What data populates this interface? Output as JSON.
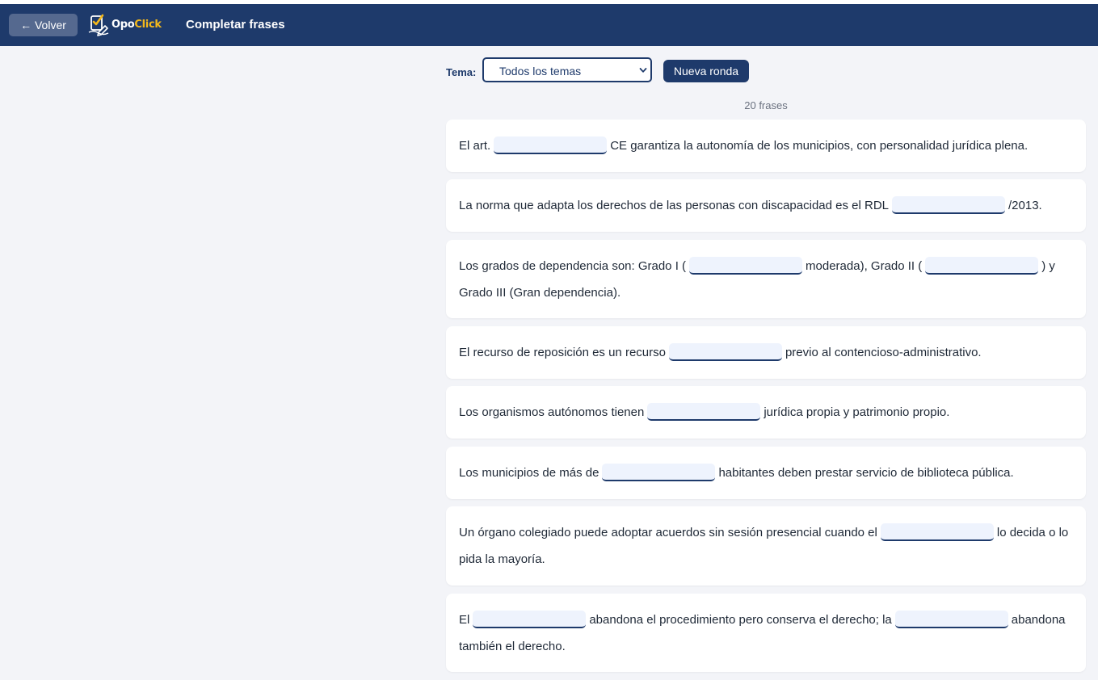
{
  "header": {
    "back_label": "← Volver",
    "logo_opo": "Opo",
    "logo_click": "Click",
    "title": "Completar frases"
  },
  "controls": {
    "tema_label": "Tema:",
    "tema_value": "Todos los temas",
    "new_round_label": "Nueva ronda"
  },
  "count_label": "20 frases",
  "sentences": [
    {
      "parts": [
        "El art.",
        "CE garantiza la autonomía de los municipios, con personalidad jurídica plena."
      ]
    },
    {
      "parts": [
        "La norma que adapta los derechos de las personas con discapacidad es el RDL",
        "/2013."
      ]
    },
    {
      "parts": [
        "Los grados de dependencia son: Grado I (",
        "moderada), Grado II (",
        ") y Grado III (Gran dependencia)."
      ]
    },
    {
      "parts": [
        "El recurso de reposición es un recurso",
        "previo al contencioso-administrativo."
      ]
    },
    {
      "parts": [
        "Los organismos autónomos tienen",
        "jurídica propia y patrimonio propio."
      ]
    },
    {
      "parts": [
        "Los municipios de más de",
        "habitantes deben prestar servicio de biblioteca pública."
      ]
    },
    {
      "parts": [
        "Un órgano colegiado puede adoptar acuerdos sin sesión presencial cuando el",
        "lo decida o lo pida la mayoría."
      ]
    },
    {
      "parts": [
        "El",
        "abandona el procedimiento pero conserva el derecho; la",
        "abandona también el derecho."
      ]
    }
  ],
  "colors": {
    "header_bg": "#1e3a6b",
    "accent": "#f5b91b",
    "blank_bg": "#eef3fd"
  }
}
